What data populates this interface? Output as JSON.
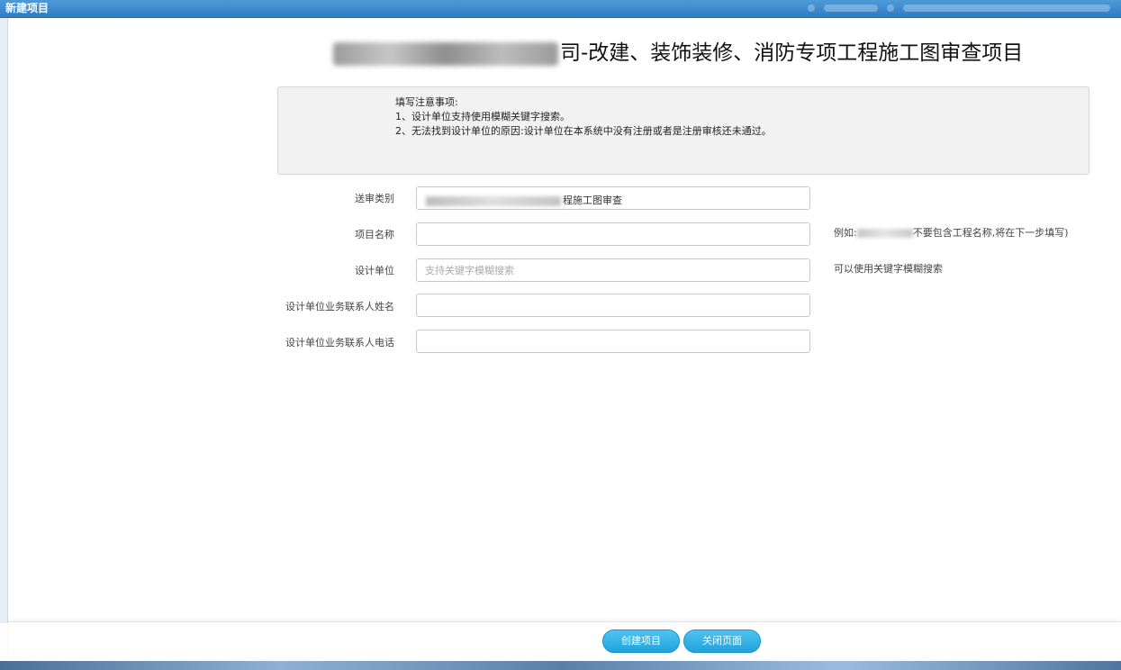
{
  "window": {
    "title": "新建项目"
  },
  "page": {
    "heading_suffix": "司-改建、装饰装修、消防专项工程施工图审查项目"
  },
  "notice": {
    "title": "填写注意事项:",
    "items": [
      "1、设计单位支持使用模糊关键字搜索。",
      "2、无法找到设计单位的原因:设计单位在本系统中没有注册或者是注册审核还未通过。"
    ]
  },
  "form": {
    "review_type": {
      "label": "送审类别",
      "value_suffix": "程施工图审查"
    },
    "project_name": {
      "label": "项目名称",
      "value": "",
      "hint_prefix": "例如:",
      "hint_suffix": "不要包含工程名称,将在下一步填写)"
    },
    "design_unit": {
      "label": "设计单位",
      "placeholder": "支持关键字模糊搜索",
      "hint": "可以使用关键字模糊搜索"
    },
    "contact_name": {
      "label": "设计单位业务联系人姓名",
      "value": ""
    },
    "contact_phone": {
      "label": "设计单位业务联系人电话",
      "value": ""
    }
  },
  "footer": {
    "create_label": "创建项目",
    "close_label": "关闭页面"
  },
  "colors": {
    "titlebar": "#2f7dc2",
    "button": "#22a3dc"
  }
}
